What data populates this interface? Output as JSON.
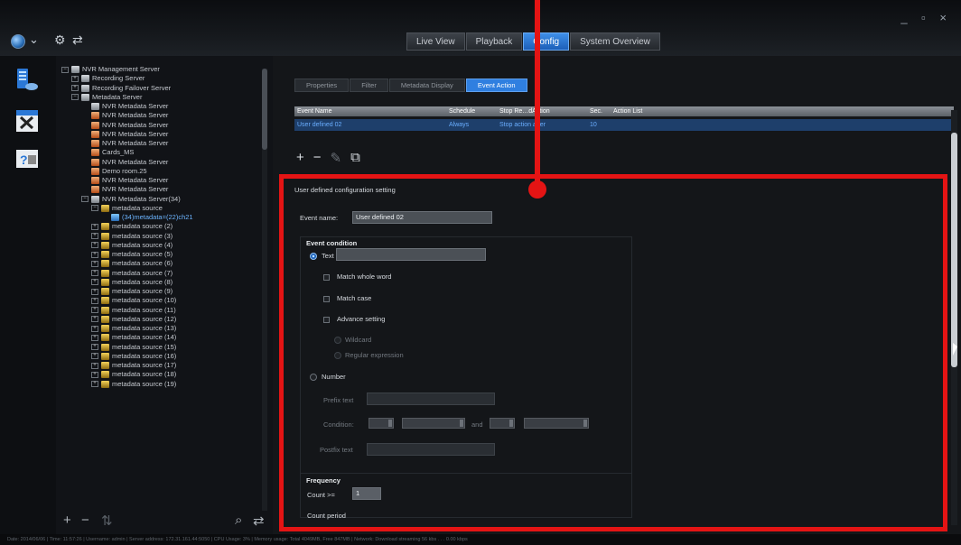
{
  "header": {
    "tabs": [
      {
        "label": "Live View"
      },
      {
        "label": "Playback"
      },
      {
        "label": "Config",
        "active": true
      },
      {
        "label": "System Overview"
      }
    ],
    "window_controls": "_ ▫ ×"
  },
  "left_rail": {
    "icons": [
      "server-tree-icon",
      "tools-icon",
      "help-icon"
    ]
  },
  "tree": {
    "items": [
      {
        "label": "NVR Management Server",
        "level": 0,
        "exp": "−",
        "icon": "server"
      },
      {
        "label": "Recording Server",
        "level": 1,
        "exp": "+",
        "icon": "server"
      },
      {
        "label": "Recording Failover Server",
        "level": 1,
        "exp": "+",
        "icon": "server"
      },
      {
        "label": "Metadata Server",
        "level": 1,
        "exp": "−",
        "icon": "server"
      },
      {
        "label": "NVR Metadata Server",
        "level": 2,
        "exp": "",
        "icon": "server"
      },
      {
        "label": "NVR Metadata Server",
        "level": 2,
        "exp": "",
        "icon": "meta"
      },
      {
        "label": "NVR Metadata Server",
        "level": 2,
        "exp": "",
        "icon": "meta"
      },
      {
        "label": "NVR Metadata Server",
        "level": 2,
        "exp": "",
        "icon": "meta"
      },
      {
        "label": "NVR Metadata Server",
        "level": 2,
        "exp": "",
        "icon": "meta"
      },
      {
        "label": "Cards_MS",
        "level": 2,
        "exp": "",
        "icon": "meta"
      },
      {
        "label": "NVR Metadata Server",
        "level": 2,
        "exp": "",
        "icon": "meta"
      },
      {
        "label": "Demo room.25",
        "level": 2,
        "exp": "",
        "icon": "meta"
      },
      {
        "label": "NVR Metadata Server",
        "level": 2,
        "exp": "",
        "icon": "meta"
      },
      {
        "label": "NVR Metadata Server",
        "level": 2,
        "exp": "",
        "icon": "meta"
      },
      {
        "label": "NVR Metadata Server(34)",
        "level": 2,
        "exp": "−",
        "icon": "server"
      },
      {
        "label": "metadata source",
        "level": 3,
        "exp": "−",
        "icon": "src"
      },
      {
        "label": "(34)metadata=(22)ch21",
        "level": 4,
        "exp": "",
        "icon": "item",
        "selected": true
      },
      {
        "label": "metadata source (2)",
        "level": 3,
        "exp": "+",
        "icon": "src"
      },
      {
        "label": "metadata source (3)",
        "level": 3,
        "exp": "+",
        "icon": "src"
      },
      {
        "label": "metadata source (4)",
        "level": 3,
        "exp": "+",
        "icon": "src"
      },
      {
        "label": "metadata source (5)",
        "level": 3,
        "exp": "+",
        "icon": "src"
      },
      {
        "label": "metadata source (6)",
        "level": 3,
        "exp": "+",
        "icon": "src"
      },
      {
        "label": "metadata source (7)",
        "level": 3,
        "exp": "+",
        "icon": "src"
      },
      {
        "label": "metadata source (8)",
        "level": 3,
        "exp": "+",
        "icon": "src"
      },
      {
        "label": "metadata source (9)",
        "level": 3,
        "exp": "+",
        "icon": "src"
      },
      {
        "label": "metadata source (10)",
        "level": 3,
        "exp": "+",
        "icon": "src"
      },
      {
        "label": "metadata source (11)",
        "level": 3,
        "exp": "+",
        "icon": "src"
      },
      {
        "label": "metadata source (12)",
        "level": 3,
        "exp": "+",
        "icon": "src"
      },
      {
        "label": "metadata source (13)",
        "level": 3,
        "exp": "+",
        "icon": "src"
      },
      {
        "label": "metadata source (14)",
        "level": 3,
        "exp": "+",
        "icon": "src"
      },
      {
        "label": "metadata source (15)",
        "level": 3,
        "exp": "+",
        "icon": "src"
      },
      {
        "label": "metadata source (16)",
        "level": 3,
        "exp": "+",
        "icon": "src"
      },
      {
        "label": "metadata source (17)",
        "level": 3,
        "exp": "+",
        "icon": "src"
      },
      {
        "label": "metadata source (18)",
        "level": 3,
        "exp": "+",
        "icon": "src"
      },
      {
        "label": "metadata source (19)",
        "level": 3,
        "exp": "+",
        "icon": "src"
      }
    ],
    "footer": {
      "add": "+",
      "remove": "−",
      "filter": "⇅",
      "search": "⌕",
      "refresh": "⇄"
    }
  },
  "subtabs": [
    {
      "label": "Properties"
    },
    {
      "label": "Filter"
    },
    {
      "label": "Metadata Display"
    },
    {
      "label": "Event Action",
      "active": true
    }
  ],
  "event_table": {
    "columns": [
      "Event Name",
      "Schedule",
      "Stop Re…dAction",
      "Sec.",
      "Action List"
    ],
    "rows": [
      [
        "User defined 02",
        "Always",
        "Stop action after",
        "10",
        ""
      ]
    ]
  },
  "event_tools": {
    "add": "+",
    "remove": "−",
    "edit": "✎",
    "copy": "⧉"
  },
  "form": {
    "section_title": "User defined configuration setting",
    "event_name_label": "Event name:",
    "event_name_value": "User defined 02",
    "event_condition_label": "Event condition",
    "text_label": "Text",
    "text_value": "",
    "match_whole_word": "Match whole word",
    "match_case": "Match case",
    "advance_setting": "Advance setting",
    "wildcard": "Wildcard",
    "regular_expression": "Regular expression",
    "number_label": "Number",
    "prefix_text": "Prefix text",
    "condition_label": "Condition:",
    "and_label": "and",
    "postfix_text": "Postfix text",
    "frequency_label": "Frequency",
    "count_label": "Count >=",
    "count_value": "1",
    "count_period": "Count period"
  },
  "status_bar": {
    "text": "Date: 2014/06/06  |  Time: 11:57:26  |  Username: admin  |  Server address: 172.31.161.44:5050  |  CPU Usage: 3%  |  Memory usage: Total 4049MB, Free 847MB  |  Network: Download streaming 56 kbs . . . 0.00 kbps"
  },
  "colors": {
    "accent": "#2f7fe0",
    "highlight": "#e41414",
    "selection": "#1e3f6b"
  }
}
